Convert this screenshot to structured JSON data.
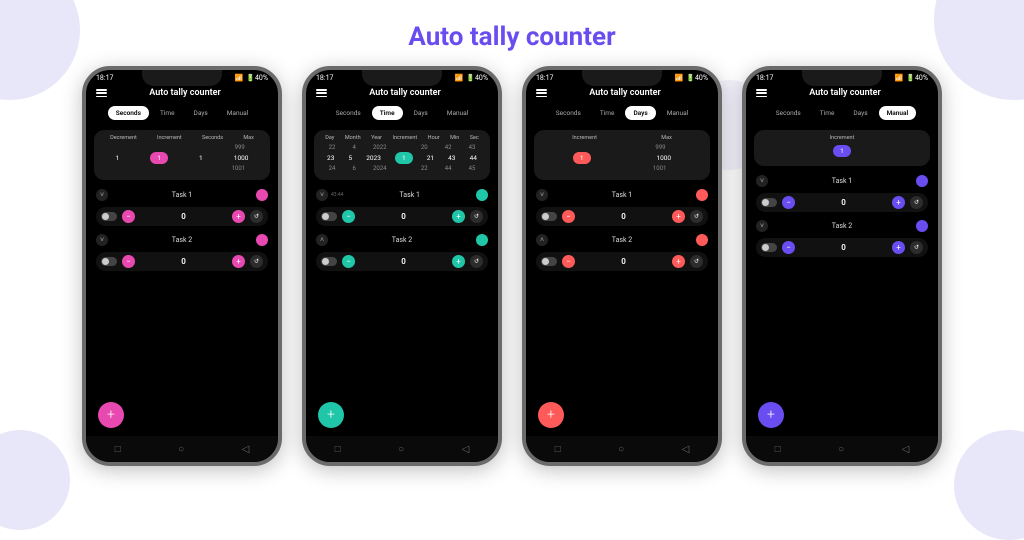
{
  "page_title": "Auto tally counter",
  "status": {
    "time": "18:17",
    "battery": "40%"
  },
  "app_title": "Auto tally counter",
  "tabs": [
    "Seconds",
    "Time",
    "Days",
    "Manual"
  ],
  "phones": [
    {
      "active_tab": 0,
      "accent": "pink",
      "settings": {
        "headers": [
          "Decrement",
          "Increment",
          "Seconds",
          "Max"
        ],
        "rows": [
          [
            "",
            "",
            "",
            "999"
          ],
          [
            "1",
            "1",
            "1",
            "1000"
          ],
          [
            "",
            "",
            "",
            "1001"
          ]
        ]
      },
      "tasks": [
        {
          "name": "Task 1",
          "value": "0",
          "expanded": false
        },
        {
          "name": "Task 2",
          "value": "0",
          "expanded": false
        }
      ]
    },
    {
      "active_tab": 1,
      "accent": "teal",
      "settings": {
        "headers": [
          "Day",
          "Month",
          "Year",
          "Increment",
          "Hour",
          "Min",
          "Sec"
        ],
        "rows": [
          [
            "22",
            "4",
            "2022",
            "",
            "20",
            "42",
            "43"
          ],
          [
            "23",
            "5",
            "2023",
            "1",
            "21",
            "43",
            "44"
          ],
          [
            "24",
            "6",
            "2024",
            "",
            "22",
            "44",
            "45"
          ]
        ]
      },
      "tasks": [
        {
          "name": "Task 1",
          "value": "0",
          "expanded": false,
          "sub": "43:44"
        },
        {
          "name": "Task 2",
          "value": "0",
          "expanded": true
        }
      ]
    },
    {
      "active_tab": 2,
      "accent": "coral",
      "settings": {
        "headers": [
          "Increment",
          "Max"
        ],
        "rows": [
          [
            "",
            "999"
          ],
          [
            "1",
            "1000"
          ],
          [
            "",
            "1001"
          ]
        ]
      },
      "tasks": [
        {
          "name": "Task 1",
          "value": "0",
          "expanded": false
        },
        {
          "name": "Task 2",
          "value": "0",
          "expanded": true
        }
      ]
    },
    {
      "active_tab": 3,
      "accent": "violet",
      "settings": {
        "headers": [
          "Increment"
        ],
        "rows": [
          [
            ""
          ],
          [
            "1"
          ],
          [
            ""
          ]
        ]
      },
      "tasks": [
        {
          "name": "Task 1",
          "value": "0",
          "expanded": false
        },
        {
          "name": "Task 2",
          "value": "0",
          "expanded": false
        }
      ]
    }
  ],
  "nav_icons": [
    "□",
    "○",
    "◁"
  ]
}
